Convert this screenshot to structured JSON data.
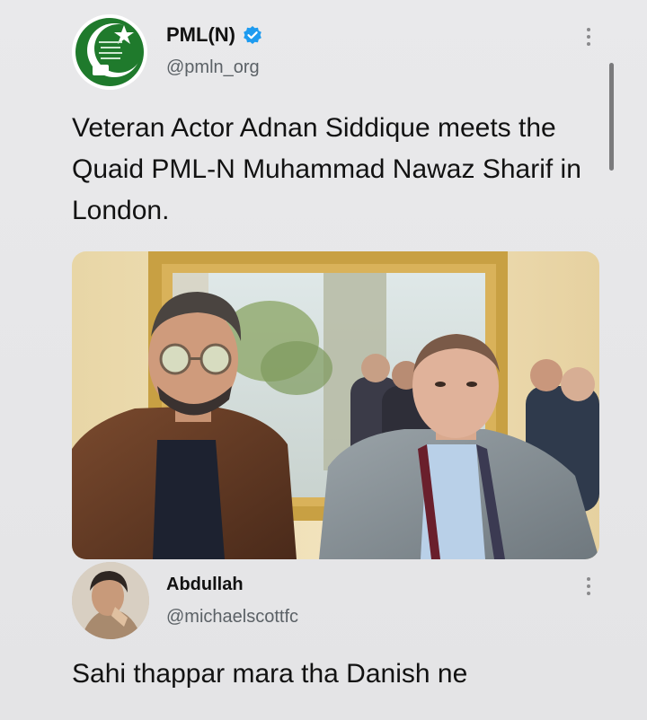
{
  "tweet": {
    "author_name": "PML(N)",
    "author_handle": "@pmln_org",
    "verified": true,
    "text": "Veteran Actor Adnan Siddique meets the Quaid PML-N Muhammad Nawaz Sharif in London.",
    "logo_mark": "PML-N"
  },
  "reply": {
    "author_name": "Abdullah",
    "author_handle": "@michaelscottfc",
    "text": "Sahi thappar mara tha Danish ne"
  },
  "icons": {
    "verified": "verified-badge-icon",
    "more": "more-options-icon"
  },
  "colors": {
    "background": "#e6e6e8",
    "verified_blue": "#1d9bf0",
    "party_green": "#1f7a2c"
  }
}
